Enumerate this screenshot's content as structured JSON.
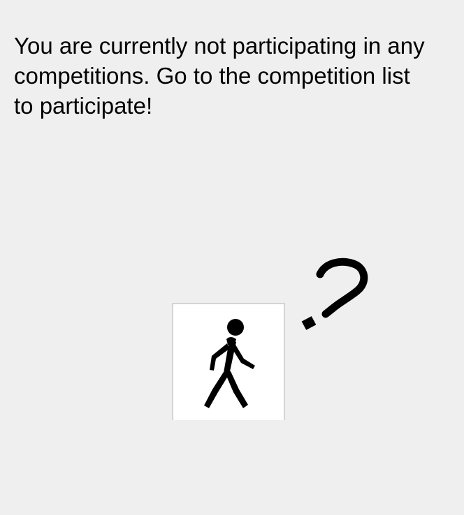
{
  "empty_state": {
    "message": "You are currently not participating in any competitions. Go to the competition list to participate!",
    "illustration_icon": "walking-person-icon",
    "illustration_badge_icon": "question-mark-icon"
  },
  "colors": {
    "background": "#efefef",
    "icon_box_background": "#ffffff",
    "icon_box_border": "#d4d4d4",
    "icon": "#000000"
  }
}
